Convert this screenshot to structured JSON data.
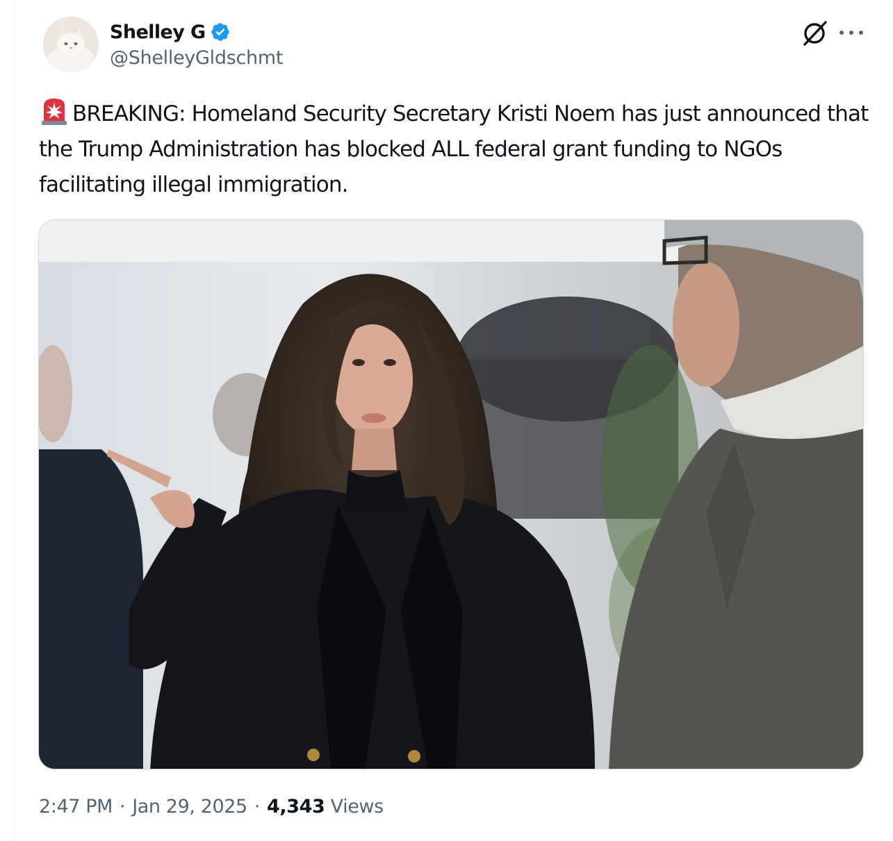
{
  "author": {
    "name": "Shelley G",
    "handle": "@ShelleyGldschmt",
    "verified": true,
    "avatar_icon": "white-persian-cat-avatar"
  },
  "header_icons": {
    "grok": "grok-icon",
    "more": "more-options-icon"
  },
  "tweet": {
    "prefix_icon": "police-siren-emoji",
    "text": "BREAKING: Homeland Security Secretary Kristi Noem has just announced that the Trump Administration has blocked ALL federal grant funding to NGOs facilitating illegal immigration."
  },
  "footer": {
    "time": "2:47 PM",
    "separator": "·",
    "date": "Jan 29, 2025",
    "views_count": "4,343",
    "views_label": "Views"
  },
  "colors": {
    "text_primary": "#0f1419",
    "text_secondary": "#536471",
    "verified_blue": "#1d9bf0",
    "siren_red": "#e0323c"
  }
}
